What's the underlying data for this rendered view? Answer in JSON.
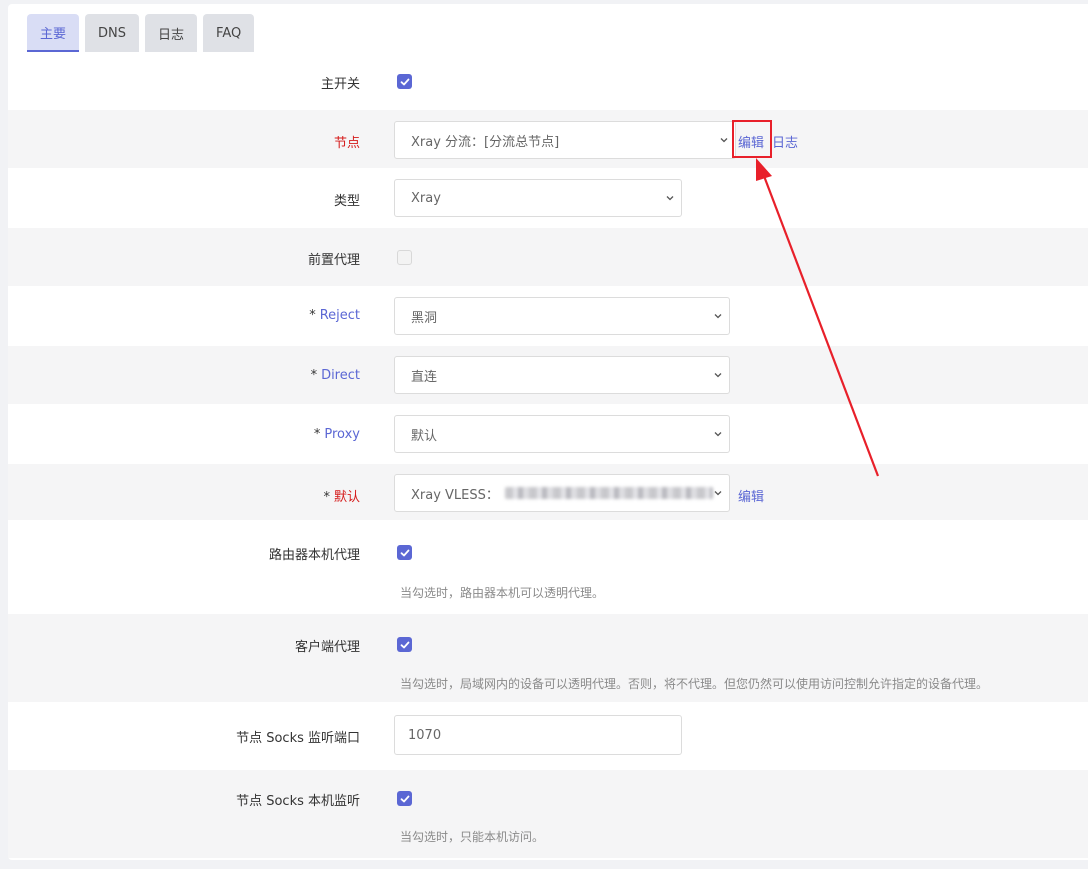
{
  "tabs": [
    "主要",
    "DNS",
    "日志",
    "FAQ"
  ],
  "fields": {
    "main_switch": {
      "label": "主开关",
      "checked": true
    },
    "node": {
      "label": "节点",
      "value": "Xray 分流：[分流总节点]",
      "edit": "编辑",
      "log": "日志"
    },
    "type": {
      "label": "类型",
      "value": "Xray"
    },
    "pre_proxy": {
      "label": "前置代理",
      "checked": false
    },
    "reject": {
      "star": "*",
      "label": "Reject",
      "value": "黑洞"
    },
    "direct": {
      "star": "*",
      "label": "Direct",
      "value": "直连"
    },
    "proxy": {
      "star": "*",
      "label": "Proxy",
      "value": "默认"
    },
    "default": {
      "star": "*",
      "label": "默认",
      "value": "Xray VLESS：",
      "edit": "编辑"
    },
    "router_proxy": {
      "label": "路由器本机代理",
      "checked": true,
      "hint": "当勾选时，路由器本机可以透明代理。"
    },
    "client_proxy": {
      "label": "客户端代理",
      "checked": true,
      "hint": "当勾选时，局域网内的设备可以透明代理。否则，将不代理。但您仍然可以使用访问控制允许指定的设备代理。"
    },
    "socks_port": {
      "label": "节点 Socks 监听端口",
      "value": "1070"
    },
    "socks_local": {
      "label": "节点 Socks 本机监听",
      "checked": true,
      "hint": "当勾选时，只能本机访问。"
    }
  },
  "colors": {
    "accent": "#5b67d4",
    "required": "#d51a1a",
    "annotation": "#e8202a"
  },
  "icons": {
    "checkbox": "check-icon",
    "select": "chevron-down-icon",
    "annotation": "red-arrow"
  }
}
